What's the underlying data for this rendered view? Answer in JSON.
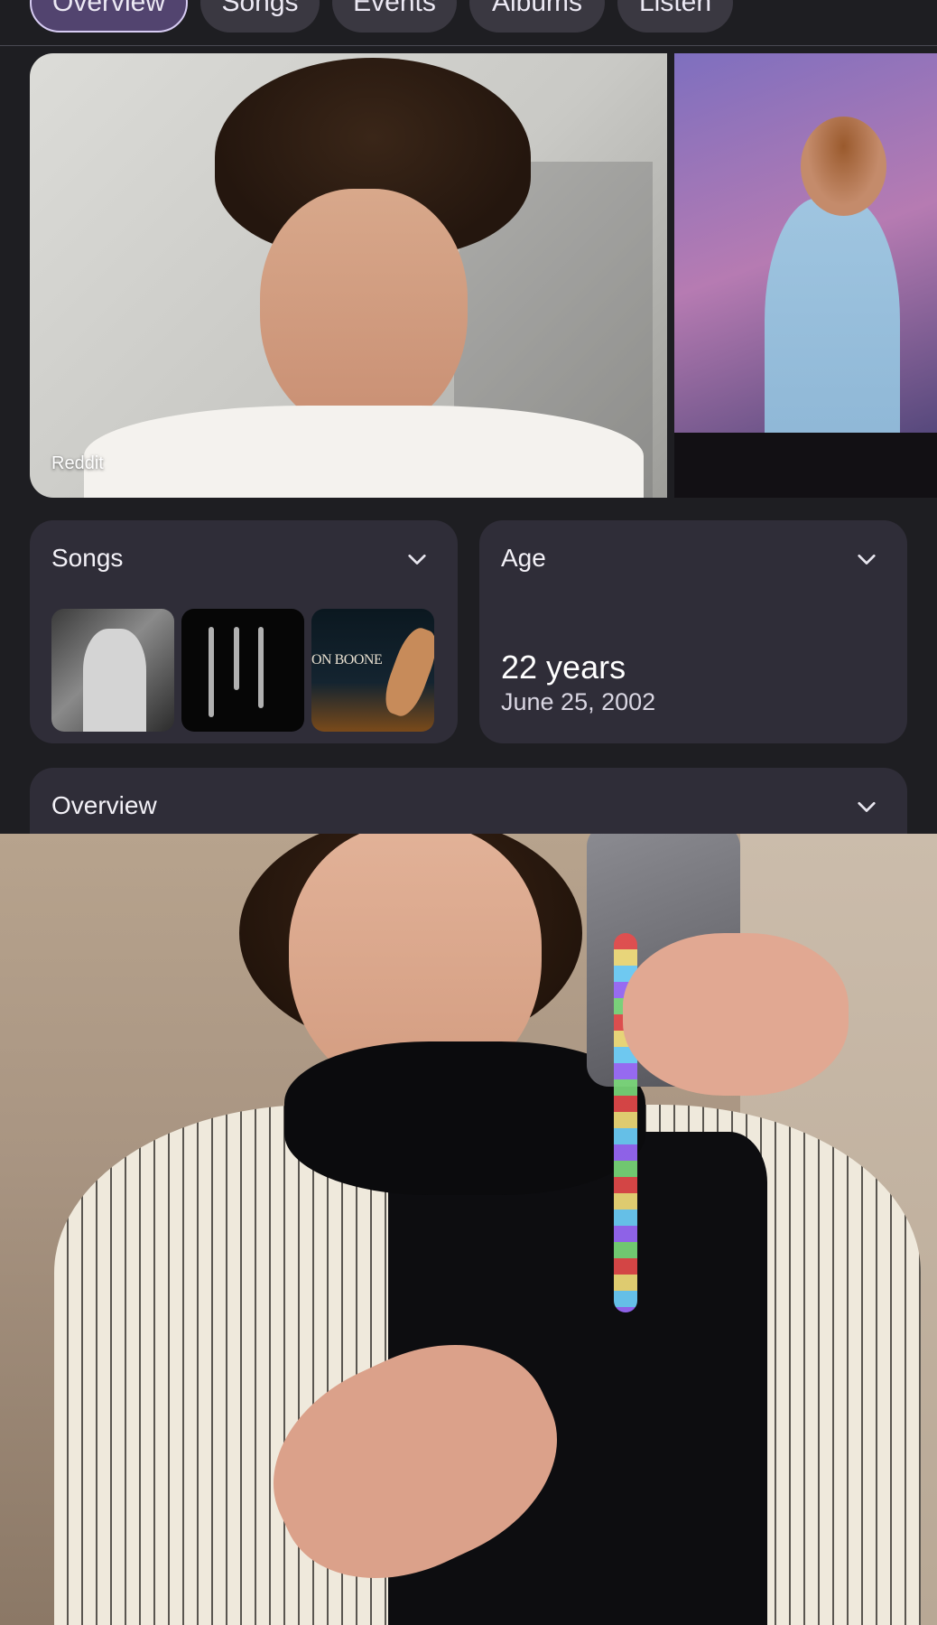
{
  "tabs": [
    {
      "label": "Overview",
      "active": true
    },
    {
      "label": "Songs",
      "active": false
    },
    {
      "label": "Events",
      "active": false
    },
    {
      "label": "Albums",
      "active": false
    },
    {
      "label": "Listen",
      "active": false
    }
  ],
  "images": {
    "main_caption": "Reddit",
    "thumb3_text": "ON BOONE"
  },
  "songs_card": {
    "title": "Songs"
  },
  "age_card": {
    "title": "Age",
    "value": "22 years",
    "date": "June 25, 2002"
  },
  "overview_card": {
    "title": "Overview"
  },
  "icons": {
    "expand": "chevron-down-icon"
  },
  "colors": {
    "background": "#1e1e22",
    "card": "#2f2d38",
    "active_tab": "#52446f"
  }
}
